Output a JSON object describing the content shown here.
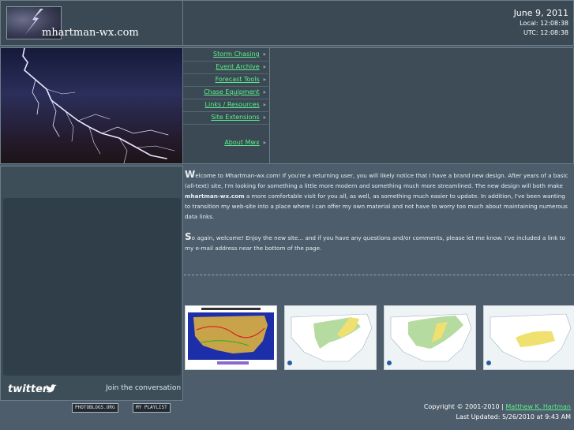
{
  "header": {
    "site_name": "mhartman-wx.com",
    "date": "June 9, 2011",
    "local_time": "Local: 12:08:38",
    "utc_time": "UTC: 12:08:38"
  },
  "nav": {
    "arrow": "»",
    "items": [
      {
        "label": "Storm Chasing"
      },
      {
        "label": "Event Archive"
      },
      {
        "label": "Forecast Tools"
      },
      {
        "label": "Chase Equipment"
      },
      {
        "label": "Links / Resources"
      },
      {
        "label": "Site Extensions"
      },
      {
        "label": "About Mwx"
      }
    ]
  },
  "sidebar": {
    "twitter_logo": "twitter",
    "join_text": "Join the conversation"
  },
  "main": {
    "para1_cap": "W",
    "para1_pre": "elcome to Mhartman-wx.com! If you're a returning user, you will likely notice that I have a brand new design. After years of a basic (all-text) site, I'm looking for something a little more modern and something much more streamlined. The new design will both make ",
    "para1_bold": "mhartman-wx.com",
    "para1_post": " a more comfortable visit for you all, as well, as something much easier to update. In addition, I've been wanting to transition my web-site into a place where I can offer my own material and not have to worry too much about maintaining numerous data links.",
    "para2_cap": "S",
    "para2_rest": "o again, welcome! Enjoy the new site... and if you have any questions and/or comments, please let me know. I've included a link to my e-mail address near the bottom of the page."
  },
  "footer": {
    "badge1": "PHOTOBLOGS.ORG",
    "badge2": "MY PLAYLIST",
    "copyright_prefix": "Copyright © 2001-2010  |  ",
    "copyright_link": "Matthew K. Hartman",
    "updated": "Last Updated:   5/26/2010 at 9:43 AM"
  },
  "colors": {
    "background": "#4d5d6b",
    "panel": "#3a4954",
    "link": "#5cf08a"
  }
}
